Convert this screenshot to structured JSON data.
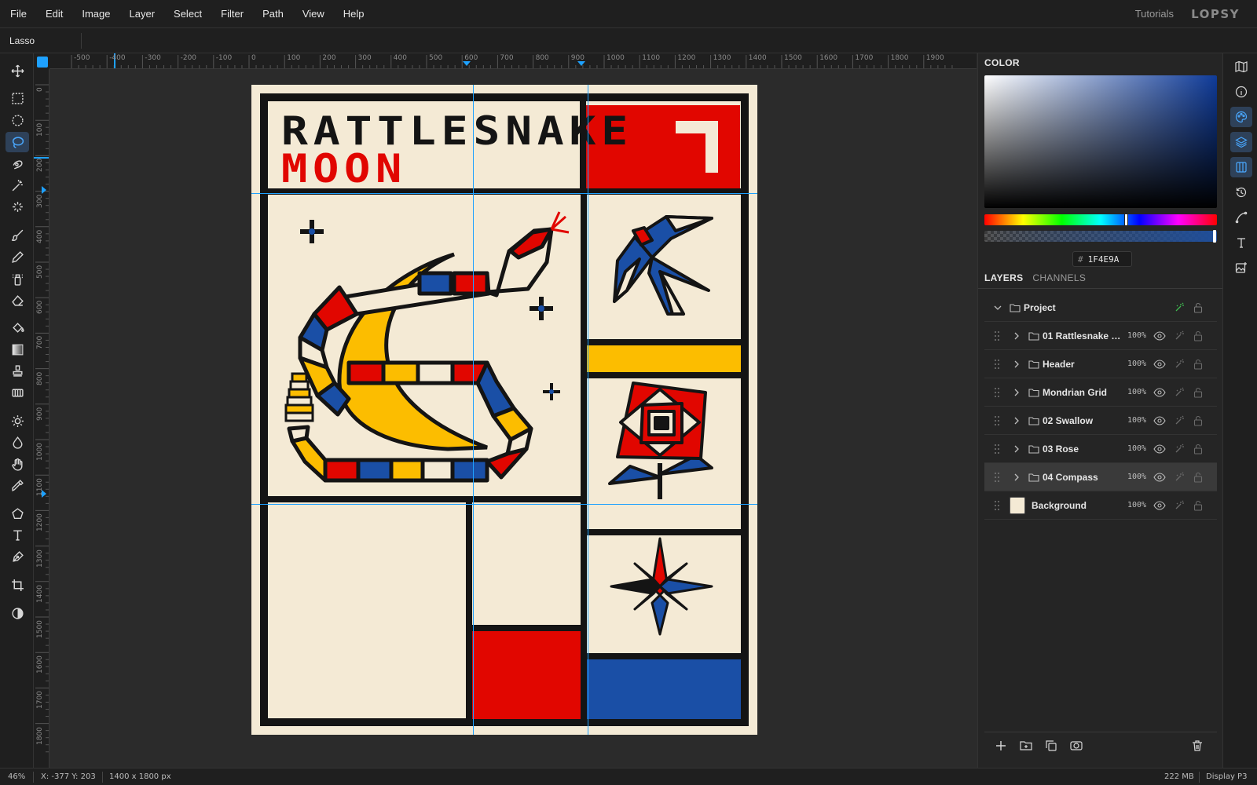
{
  "app": {
    "brand": "LOPSY",
    "tutorials": "Tutorials"
  },
  "menu": [
    "File",
    "Edit",
    "Image",
    "Layer",
    "Select",
    "Filter",
    "Path",
    "View",
    "Help"
  ],
  "options_bar": {
    "tool_name": "Lasso"
  },
  "toolbar": {
    "tools": [
      "move-icon",
      "marquee-rect-icon",
      "marquee-ellipse-icon",
      "lasso-icon",
      "quick-select-icon",
      "magic-wand-icon",
      "spot-heal-icon",
      "brush-icon",
      "pencil-icon",
      "clone-icon",
      "eraser-icon",
      "paint-bucket-icon",
      "gradient-icon",
      "stamp-icon",
      "pattern-icon",
      "dodge-icon",
      "burn-icon",
      "hand-icon",
      "eyedropper-icon",
      "polygon-icon",
      "text-icon",
      "pen-icon",
      "crop-icon",
      "contrast-icon"
    ],
    "active": "lasso-icon"
  },
  "rulers": {
    "top_ticks": [
      "-500",
      "-400",
      "-300",
      "-200",
      "-100",
      "0",
      "100",
      "200",
      "300",
      "400",
      "500",
      "600",
      "700",
      "800",
      "900",
      "1000",
      "1100",
      "1200",
      "1300",
      "1400",
      "1500",
      "1600",
      "1700",
      "1800",
      "1900"
    ],
    "left_ticks": [
      "0",
      "100",
      "200",
      "300",
      "400",
      "500",
      "600",
      "700",
      "800",
      "900",
      "1000",
      "1100",
      "1200",
      "1300",
      "1400",
      "1500",
      "1600",
      "1700",
      "1800"
    ]
  },
  "artwork": {
    "title_line1": "RATTLESNAKE",
    "title_line2": "MOON",
    "colors": {
      "cream": "#f4ead5",
      "ink": "#141414",
      "red": "#e10600",
      "blue": "#1a4fa6",
      "yellow": "#fcbd00"
    }
  },
  "color_panel": {
    "title": "COLOR",
    "hex_prefix": "#",
    "hex": "1F4E9A",
    "current_color": "#1f4e9a"
  },
  "layers_panel": {
    "tabs": [
      "LAYERS",
      "CHANNELS"
    ],
    "active_tab": "LAYERS",
    "project": "Project",
    "layers": [
      {
        "name": "01 Rattlesnake M...",
        "opacity": "100%",
        "type": "group"
      },
      {
        "name": "Header",
        "opacity": "100%",
        "type": "group"
      },
      {
        "name": "Mondrian Grid",
        "opacity": "100%",
        "type": "group"
      },
      {
        "name": "02 Swallow",
        "opacity": "100%",
        "type": "group"
      },
      {
        "name": "03 Rose",
        "opacity": "100%",
        "type": "group"
      },
      {
        "name": "04 Compass",
        "opacity": "100%",
        "type": "group",
        "selected": true
      },
      {
        "name": "Background",
        "opacity": "100%",
        "type": "pixel"
      }
    ],
    "footer_buttons": [
      "add-layer-icon",
      "new-group-icon",
      "duplicate-icon",
      "mask-icon",
      "trash-icon"
    ]
  },
  "right_strip": [
    "map-icon",
    "info-icon",
    "palette-icon",
    "layers-icon",
    "columns-icon",
    "history-icon",
    "curve-icon",
    "type-icon",
    "image-add-icon"
  ],
  "status": {
    "zoom": "46%",
    "cursor": "X: -377 Y: 203",
    "doc_size": "1400 x 1800 px",
    "memory": "222 MB",
    "color_profile": "Display P3"
  }
}
